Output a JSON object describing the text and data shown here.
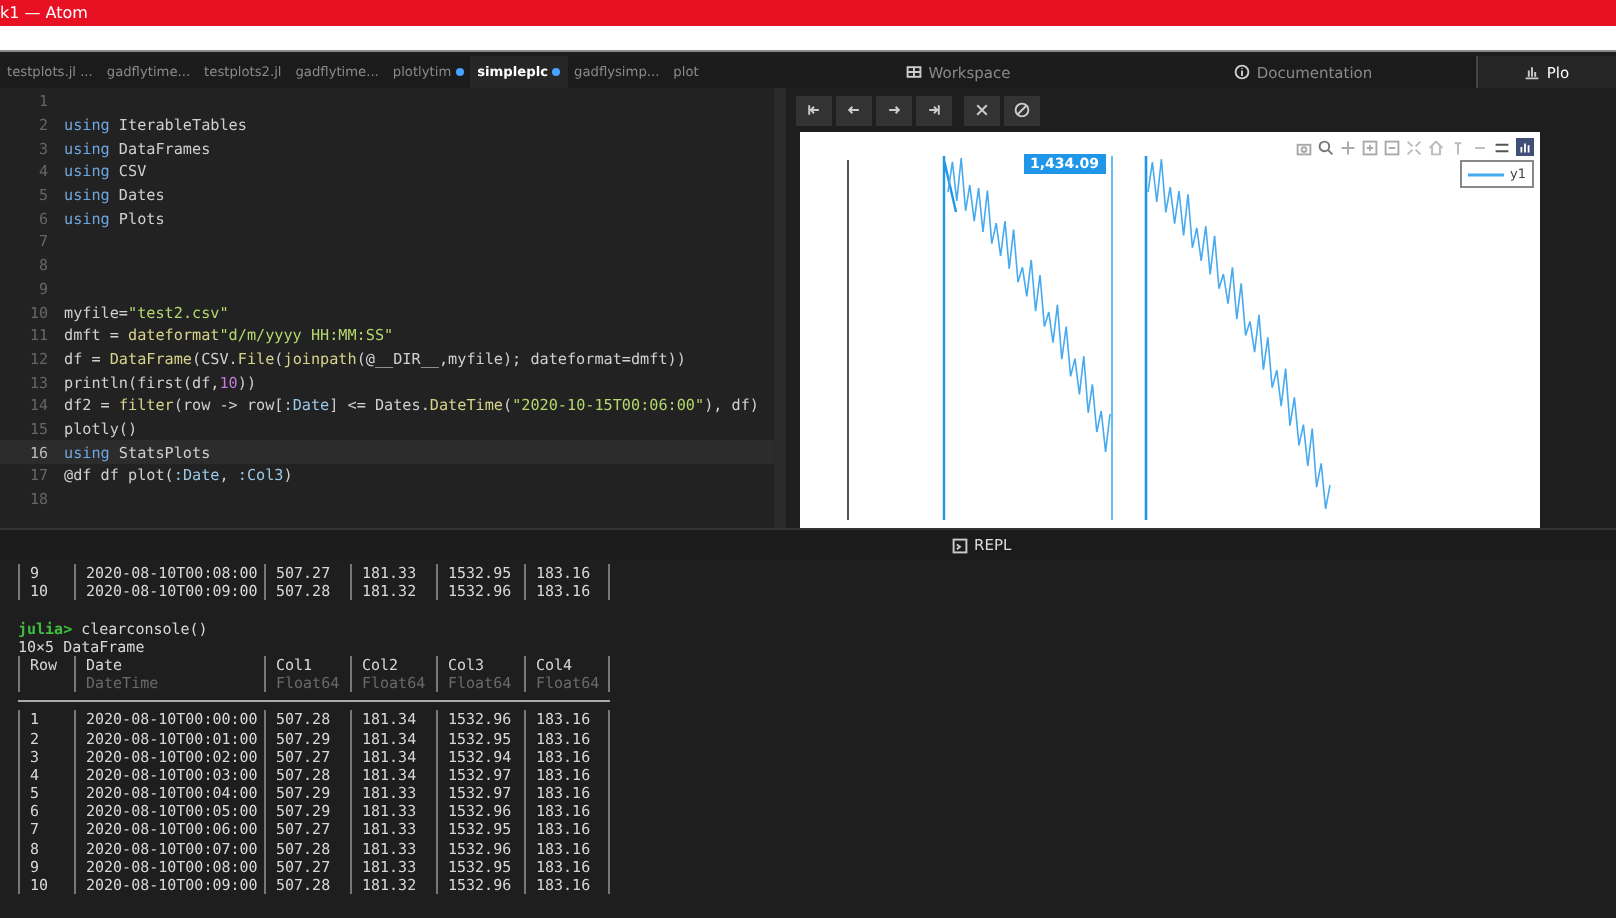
{
  "window": {
    "title": "k1 — Atom"
  },
  "tabs": [
    {
      "label": "testplots.jl ...",
      "selected": false,
      "modified": false
    },
    {
      "label": "gadflytime...",
      "selected": false,
      "modified": false
    },
    {
      "label": "testplots2.jl",
      "selected": false,
      "modified": false
    },
    {
      "label": "gadflytime...",
      "selected": false,
      "modified": false
    },
    {
      "label": "plotlytim",
      "selected": false,
      "modified": true
    },
    {
      "label": "simpleplc",
      "selected": true,
      "modified": true
    },
    {
      "label": "gadflysimp...",
      "selected": false,
      "modified": false
    },
    {
      "label": "plot",
      "selected": false,
      "modified": false
    }
  ],
  "editor": {
    "lines": [
      {
        "number": "1",
        "current": false
      },
      {
        "number": "2",
        "current": false,
        "tokens": [
          {
            "kind": "keyword",
            "text": "using"
          },
          {
            "kind": "plain",
            "text": " IterableTables"
          }
        ]
      },
      {
        "number": "3",
        "current": false,
        "tokens": [
          {
            "kind": "keyword",
            "text": "using"
          },
          {
            "kind": "plain",
            "text": " DataFrames"
          }
        ]
      },
      {
        "number": "4",
        "current": false,
        "tokens": [
          {
            "kind": "keyword",
            "text": "using"
          },
          {
            "kind": "plain",
            "text": " CSV"
          }
        ]
      },
      {
        "number": "5",
        "current": false,
        "tokens": [
          {
            "kind": "keyword",
            "text": "using"
          },
          {
            "kind": "plain",
            "text": " Dates"
          }
        ]
      },
      {
        "number": "6",
        "current": false,
        "tokens": [
          {
            "kind": "keyword",
            "text": "using"
          },
          {
            "kind": "plain",
            "text": " Plots"
          }
        ]
      },
      {
        "number": "7",
        "current": false
      },
      {
        "number": "8",
        "current": false
      },
      {
        "number": "9",
        "current": false
      },
      {
        "number": "10",
        "current": false,
        "tokens": [
          {
            "kind": "plain",
            "text": "myfile="
          },
          {
            "kind": "string",
            "text": "\"test2.csv\""
          }
        ]
      },
      {
        "number": "11",
        "current": false,
        "tokens": [
          {
            "kind": "plain",
            "text": "dmft = "
          },
          {
            "kind": "call",
            "text": "dateformat"
          },
          {
            "kind": "string",
            "text": "\"d/m/yyyy HH:MM:SS\""
          }
        ]
      },
      {
        "number": "12",
        "current": false,
        "tokens": [
          {
            "kind": "plain",
            "text": "df = "
          },
          {
            "kind": "call",
            "text": "DataFrame"
          },
          {
            "kind": "plain",
            "text": "(CSV."
          },
          {
            "kind": "call",
            "text": "File"
          },
          {
            "kind": "plain",
            "text": "("
          },
          {
            "kind": "call",
            "text": "joinpath"
          },
          {
            "kind": "plain",
            "text": "(@__DIR__,myfile); dateformat=dmft))"
          }
        ]
      },
      {
        "number": "13",
        "current": false,
        "tokens": [
          {
            "kind": "plain",
            "text": "println(first(df,"
          },
          {
            "kind": "number",
            "text": "10"
          },
          {
            "kind": "plain",
            "text": "))"
          }
        ]
      },
      {
        "number": "14",
        "current": false,
        "tokens": [
          {
            "kind": "plain",
            "text": "df2 = "
          },
          {
            "kind": "call",
            "text": "filter"
          },
          {
            "kind": "plain",
            "text": "(row -> row["
          },
          {
            "kind": "symbol",
            "text": ":Date"
          },
          {
            "kind": "plain",
            "text": "] <= Dates."
          },
          {
            "kind": "call",
            "text": "DateTime"
          },
          {
            "kind": "plain",
            "text": "("
          },
          {
            "kind": "string",
            "text": "\"2020-10-15T00:06:00\""
          },
          {
            "kind": "plain",
            "text": "), df)"
          }
        ]
      },
      {
        "number": "15",
        "current": false,
        "tokens": [
          {
            "kind": "plain",
            "text": "plotly()"
          }
        ]
      },
      {
        "number": "16",
        "current": true,
        "tokens": [
          {
            "kind": "keyword",
            "text": "using"
          },
          {
            "kind": "plain",
            "text": " StatsPlots"
          }
        ]
      },
      {
        "number": "17",
        "current": false,
        "tokens": [
          {
            "kind": "plain",
            "text": "@df df plot("
          },
          {
            "kind": "symbol",
            "text": ":Date"
          },
          {
            "kind": "plain",
            "text": ", "
          },
          {
            "kind": "symbol",
            "text": ":Col3"
          },
          {
            "kind": "plain",
            "text": ")"
          }
        ]
      },
      {
        "number": "18",
        "current": false
      }
    ]
  },
  "dock_tabs": [
    {
      "label": "Workspace",
      "selected": false
    },
    {
      "label": "Documentation",
      "selected": false
    },
    {
      "label": "Plo",
      "selected": true
    }
  ],
  "plot": {
    "legend": "y1",
    "hover_label": "1,434.09"
  },
  "repl_tab": {
    "label": "REPL"
  },
  "console": {
    "previous_rows": [
      [
        "9",
        "2020-08-10T00:08:00",
        "507.27",
        "181.33",
        "1532.95",
        "183.16"
      ],
      [
        "10",
        "2020-08-10T00:09:00",
        "507.28",
        "181.32",
        "1532.96",
        "183.16"
      ]
    ],
    "prompt": "julia>",
    "command": "clearconsole()",
    "summary": "10×5 DataFrame",
    "columns": [
      {
        "name": "Row"
      },
      {
        "name": "Date",
        "type": "DateTime"
      },
      {
        "name": "Col1",
        "type": "Float64"
      },
      {
        "name": "Col2",
        "type": "Float64"
      },
      {
        "name": "Col3",
        "type": "Float64"
      },
      {
        "name": "Col4",
        "type": "Float64"
      }
    ],
    "rows": [
      [
        "1",
        "2020-08-10T00:00:00",
        "507.28",
        "181.34",
        "1532.96",
        "183.16"
      ],
      [
        "2",
        "2020-08-10T00:01:00",
        "507.29",
        "181.34",
        "1532.95",
        "183.16"
      ],
      [
        "3",
        "2020-08-10T00:02:00",
        "507.27",
        "181.34",
        "1532.94",
        "183.16"
      ],
      [
        "4",
        "2020-08-10T00:03:00",
        "507.28",
        "181.34",
        "1532.97",
        "183.16"
      ],
      [
        "5",
        "2020-08-10T00:04:00",
        "507.29",
        "181.33",
        "1532.97",
        "183.16"
      ],
      [
        "6",
        "2020-08-10T00:05:00",
        "507.29",
        "181.33",
        "1532.96",
        "183.16"
      ],
      [
        "7",
        "2020-08-10T00:06:00",
        "507.27",
        "181.33",
        "1532.95",
        "183.16"
      ],
      [
        "8",
        "2020-08-10T00:07:00",
        "507.28",
        "181.33",
        "1532.96",
        "183.16"
      ],
      [
        "9",
        "2020-08-10T00:08:00",
        "507.27",
        "181.33",
        "1532.95",
        "183.16"
      ],
      [
        "10",
        "2020-08-10T00:09:00",
        "507.28",
        "181.32",
        "1532.96",
        "183.16"
      ]
    ]
  }
}
